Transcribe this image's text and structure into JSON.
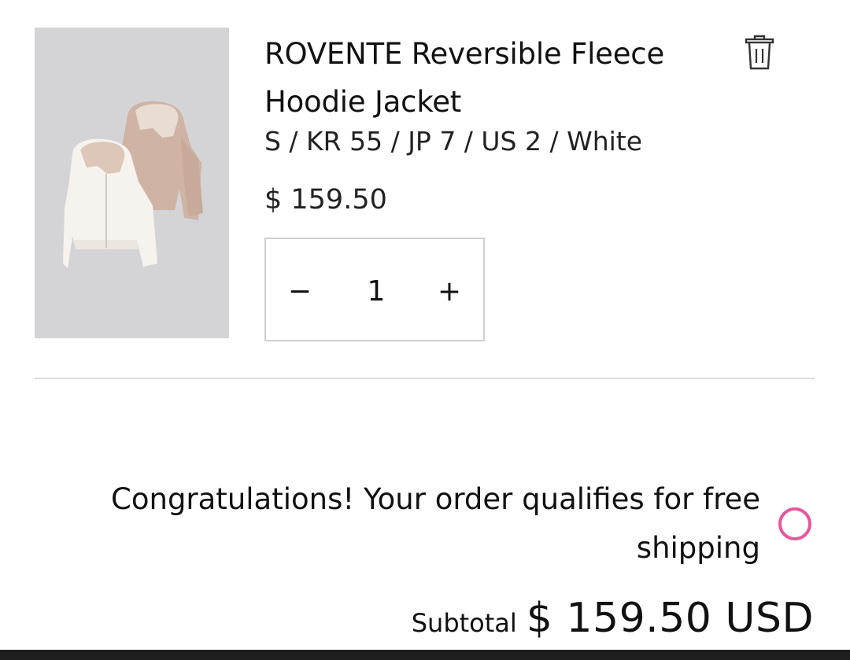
{
  "cart_item": {
    "product_name": "ROVENTE Reversible Fleece Hoodie Jacket",
    "variant": "S / KR 55 / JP 7 / US 2 / White",
    "price": "$ 159.50",
    "quantity": "1",
    "decrement_label": "−",
    "increment_label": "+",
    "remove_icon": "trash-icon",
    "image_icon": "hoodie-jacket-image"
  },
  "shipping": {
    "message": "Congratulations! Your order qualifies for free shipping",
    "indicator_color": "#e8579a"
  },
  "summary": {
    "subtotal_label": "Subtotal",
    "subtotal_amount": "$ 159.50 USD"
  }
}
